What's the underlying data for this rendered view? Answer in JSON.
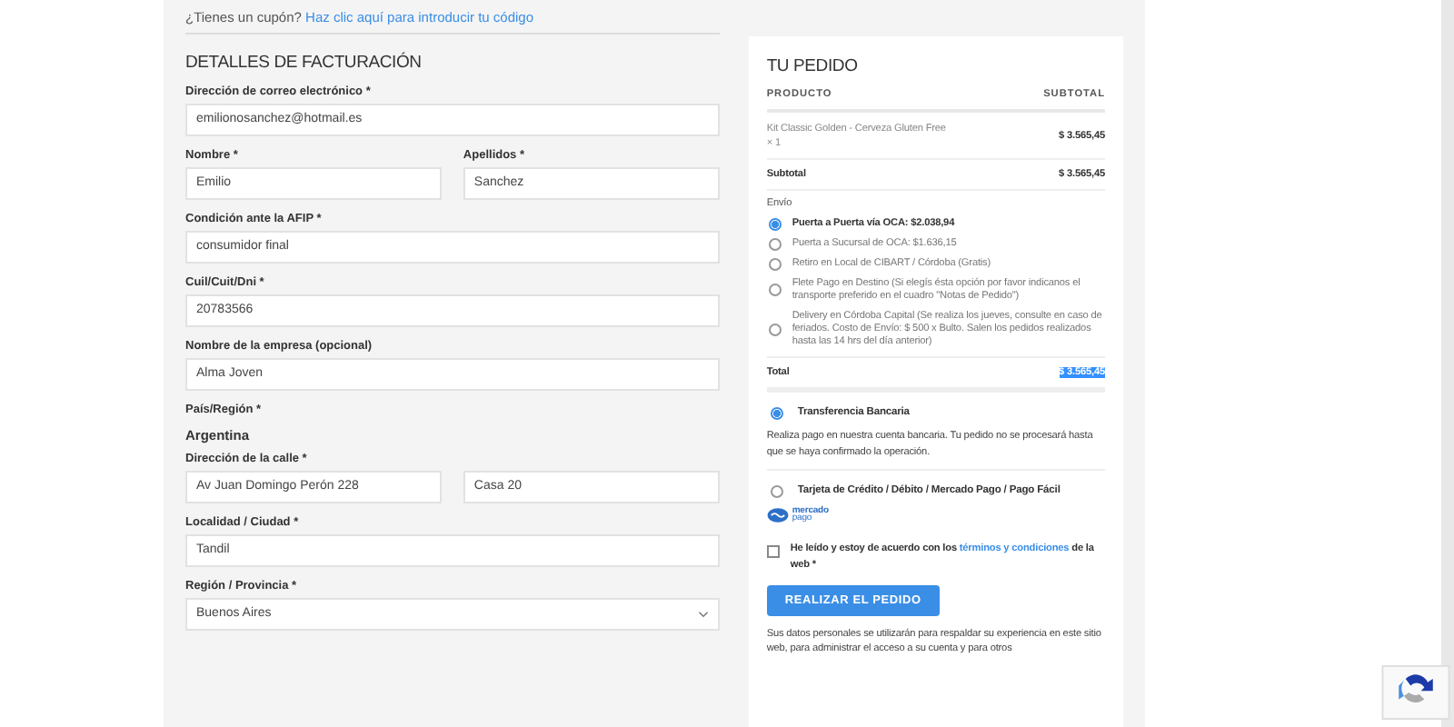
{
  "coupon": {
    "text": "¿Tienes un cupón?",
    "link": "Haz clic aquí para introducir tu código"
  },
  "billing": {
    "title": "DETALLES DE FACTURACIÓN",
    "fields": [
      {
        "kind": "input",
        "label": "Dirección de correo electrónico *",
        "value": "emilionosanchez@hotmail.es"
      },
      {
        "kind": "pair",
        "fields": [
          {
            "label": "Nombre *",
            "value": "Emilio"
          },
          {
            "label": "Apellidos *",
            "value": "Sanchez"
          }
        ]
      },
      {
        "kind": "input",
        "label": "Condición ante la AFIP *",
        "value": "consumidor final"
      },
      {
        "kind": "input",
        "label": "Cuil/Cuit/Dni *",
        "value": "20783566"
      },
      {
        "kind": "input",
        "label": "Nombre de la empresa (opcional)",
        "value": "Alma Joven"
      },
      {
        "kind": "static",
        "label": "País/Región *",
        "value": "Argentina"
      },
      {
        "kind": "double",
        "label": "Dirección de la calle *",
        "values": [
          "Av Juan Domingo Perón 228",
          "Casa 20"
        ]
      },
      {
        "kind": "input",
        "label": "Localidad / Ciudad *",
        "value": "Tandil"
      },
      {
        "kind": "select",
        "label": "Región / Provincia *",
        "value": "Buenos Aires"
      }
    ]
  },
  "order": {
    "title": "TU PEDIDO",
    "columns": [
      "PRODUCTO",
      "SUBTOTAL"
    ],
    "items": [
      {
        "name": "Kit Classic Golden - Cerveza Gluten Free",
        "qty": "× 1",
        "price": "$ 3.565,45"
      }
    ],
    "subtotal": {
      "label": "Subtotal",
      "value": "$ 3.565,45"
    },
    "shipping": {
      "label": "Envío",
      "options": [
        {
          "label": "Puerta a Puerta vía OCA: $2.038,94",
          "selected": true
        },
        {
          "label": "Puerta a Sucursal de OCA: $1.636,15",
          "selected": false
        },
        {
          "label": "Retiro en Local de CIBART / Córdoba (Gratis)",
          "selected": false
        },
        {
          "label": "Flete Pago en Destino (Si elegís ésta opción por favor indicanos el transporte preferido en el cuadro \"Notas de Pedido\")",
          "selected": false
        },
        {
          "label": "Delivery en Córdoba Capital (Se realiza los jueves, consulte en caso de feriados. Costo de Envío: $ 500 x Bulto. Salen los pedidos realizados hasta las 14 hrs del día anterior)",
          "selected": false
        }
      ]
    },
    "total": {
      "label": "Total",
      "value": "$ 3.565,45",
      "highlighted": true
    }
  },
  "payment": {
    "methods": [
      {
        "label": "Transferencia Bancaria",
        "selected": true,
        "description": "Realiza pago en nuestra cuenta bancaria. Tu pedido no se procesará hasta que se haya confirmado la operación."
      },
      {
        "label": "Tarjeta de Crédito / Débito / Mercado Pago / Pago Fácil",
        "selected": false,
        "logo": [
          "mercado",
          "pago"
        ]
      }
    ],
    "terms": {
      "before": "He leído y estoy de acuerdo con los",
      "link": "términos y condiciones",
      "after": "de la web *",
      "checked": false
    },
    "button": "REALIZAR EL PEDIDO",
    "privacy": "Sus datos personales se utilizarán para respaldar su experiencia en este sitio web, para administrar el acceso a su cuenta y para otros"
  }
}
